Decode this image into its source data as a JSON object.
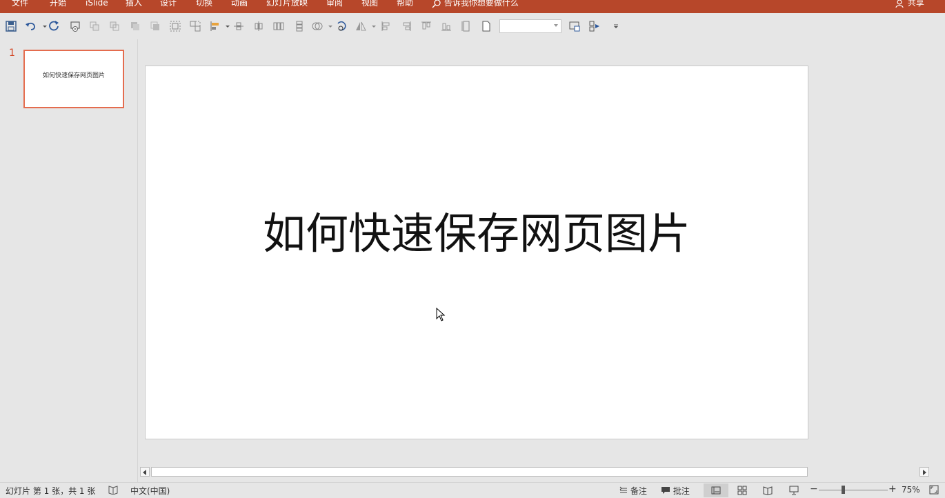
{
  "ribbon": {
    "tabs": [
      "文件",
      "开始",
      "iSlide",
      "插入",
      "设计",
      "切换",
      "动画",
      "幻灯片放映",
      "审阅",
      "视图",
      "帮助"
    ],
    "tell_me": "告诉我你想要做什么",
    "share": "共享"
  },
  "thumbnails": {
    "slide_number": "1",
    "slide_title": "如何快速保存网页图片"
  },
  "slide": {
    "title": "如何快速保存网页图片"
  },
  "status": {
    "slide_info": "幻灯片 第 1 张，共 1 张",
    "language": "中文(中国)",
    "notes": "备注",
    "comments": "批注",
    "zoom": "75%",
    "zoom_minus": "−",
    "zoom_plus": "+"
  },
  "colors": {
    "ribbon": "#b7472a",
    "accent": "#d24726"
  }
}
